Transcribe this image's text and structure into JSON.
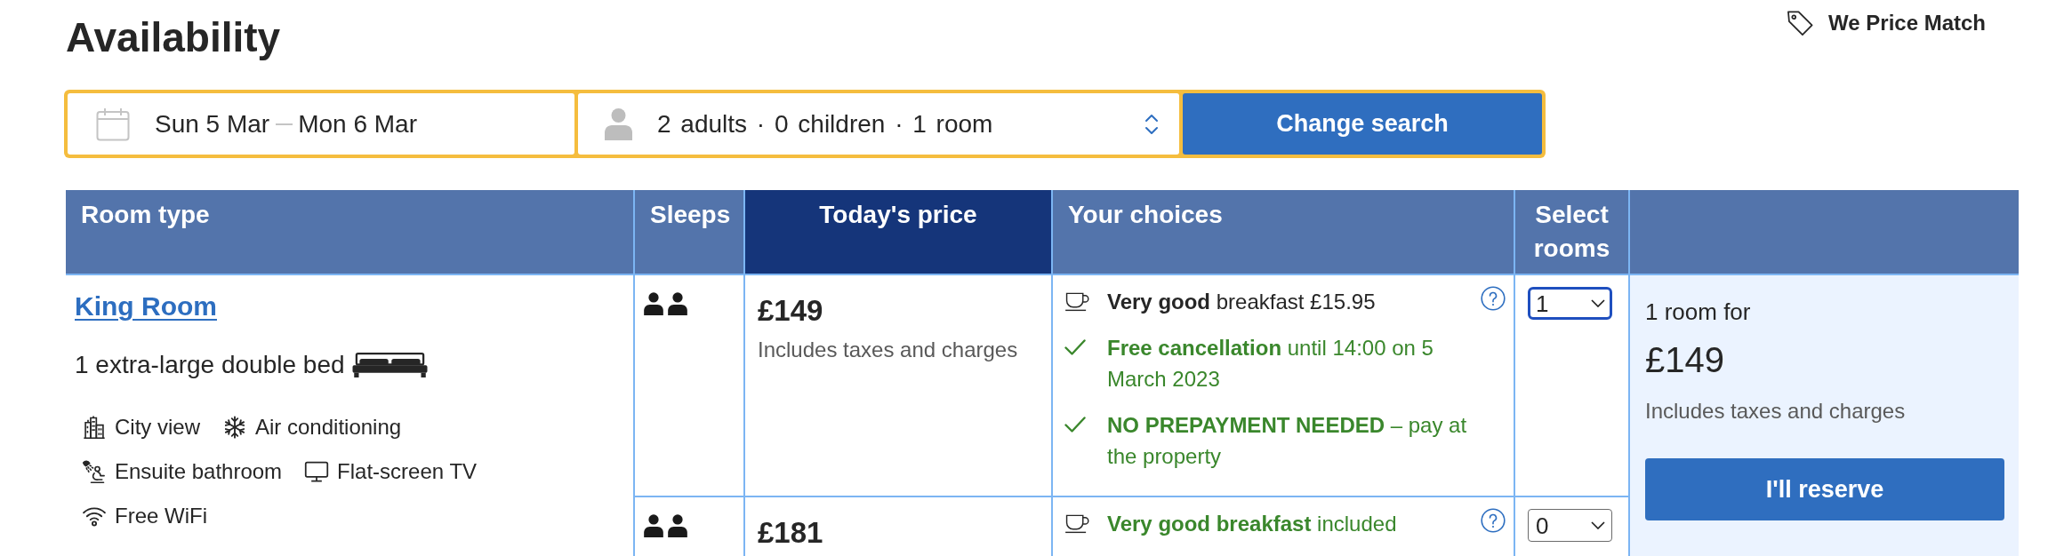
{
  "header": {
    "title": "Availability",
    "price_match": "We Price Match"
  },
  "search": {
    "check_in": "Sun 5 Mar",
    "check_out": "Mon 6 Mar",
    "guests": "2 adults · 0 children · 1 room",
    "button": "Change search"
  },
  "table": {
    "columns": [
      {
        "label": "Room type",
        "highlighted": false
      },
      {
        "label": "Sleeps",
        "highlighted": false
      },
      {
        "label": "Today's price",
        "highlighted": true
      },
      {
        "label": "Your choices",
        "highlighted": false
      },
      {
        "label": "Select rooms",
        "highlighted": false
      }
    ],
    "room": {
      "name": "King Room",
      "bed": "1 extra-large double bed",
      "facilities": [
        {
          "kind": "view",
          "label": "City view"
        },
        {
          "kind": "aircon",
          "label": "Air conditioning"
        },
        {
          "kind": "bathroom",
          "label": "Ensuite bathroom"
        },
        {
          "kind": "tv",
          "label": "Flat-screen TV"
        },
        {
          "kind": "wifi",
          "label": "Free WiFi"
        }
      ]
    },
    "options": [
      {
        "sleeps": [
          {
            "kind": "adult"
          },
          {
            "kind": "adult"
          }
        ],
        "price": "£149",
        "price_note": "Includes taxes and charges",
        "choices": [
          {
            "kind": "meal",
            "text": "**Very good** breakfast £15.95",
            "included": false,
            "info": true
          },
          {
            "kind": "policy",
            "text": "**Free cancellation** until 14:00 on 5 March 2023",
            "info": false
          },
          {
            "kind": "policy",
            "text": "**NO PREPAYMENT NEEDED** – pay at the property",
            "info": false
          }
        ],
        "select": {
          "value": "1",
          "focused": true
        }
      },
      {
        "sleeps": [
          {
            "kind": "adult"
          },
          {
            "kind": "adult"
          }
        ],
        "price": "£181",
        "choices": [
          {
            "kind": "meal",
            "text": "**Very good breakfast** included",
            "included": true,
            "info": true
          }
        ],
        "select": {
          "value": "0",
          "focused": false
        }
      }
    ],
    "summary": {
      "rooms_label": "1 room for",
      "price": "£149",
      "price_note": "Includes taxes and charges",
      "button": "I'll reserve"
    }
  }
}
